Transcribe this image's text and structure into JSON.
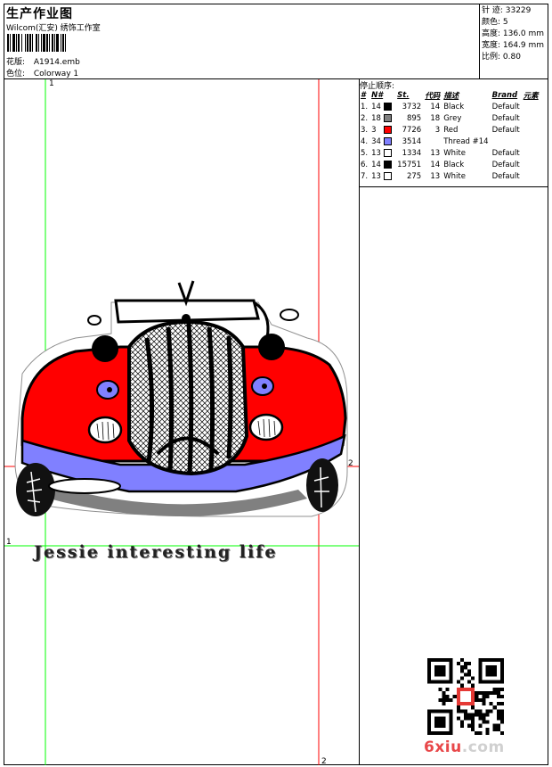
{
  "header": {
    "title": "生产作业图",
    "subtitle": "Wilcom(汇安) 绣饰工作室",
    "design_label": "花版:",
    "design_value": "A1914.emb",
    "colorway_label": "色位:",
    "colorway_value": "Colorway 1"
  },
  "stats": {
    "stitches": "针 迹: 33229",
    "colors": "颜色: 5",
    "height": "高度: 136.0 mm",
    "width": "宽度: 164.9 mm",
    "scale": "比例: 0.80"
  },
  "stop_sequence": {
    "title": "停止顺序:",
    "headers": [
      "#",
      "N#",
      "St.",
      "代码",
      "描述",
      "Brand",
      "元素"
    ],
    "rows": [
      {
        "n": "1.",
        "needle": "14",
        "color": "#000000",
        "st": "3732",
        "code": "14",
        "desc": "Black",
        "brand": "Default"
      },
      {
        "n": "2.",
        "needle": "18",
        "color": "#808080",
        "st": "895",
        "code": "18",
        "desc": "Grey",
        "brand": "Default"
      },
      {
        "n": "3.",
        "needle": "3",
        "color": "#ff0000",
        "st": "7726",
        "code": "3",
        "desc": "Red",
        "brand": "Default"
      },
      {
        "n": "4.",
        "needle": "34",
        "color": "#8080ff",
        "st": "3514",
        "code": "",
        "desc": "Thread #14",
        "brand": ""
      },
      {
        "n": "5.",
        "needle": "13",
        "color": "#ffffff",
        "st": "1334",
        "code": "13",
        "desc": "White",
        "brand": "Default"
      },
      {
        "n": "6.",
        "needle": "14",
        "color": "#000000",
        "st": "15751",
        "code": "14",
        "desc": "Black",
        "brand": "Default"
      },
      {
        "n": "7.",
        "needle": "13",
        "color": "#ffffff",
        "st": "275",
        "code": "13",
        "desc": "White",
        "brand": "Default"
      }
    ]
  },
  "design": {
    "slogan": "Jessie interesting life",
    "guide_marks": [
      "1",
      "2",
      "1",
      "2"
    ],
    "colors": {
      "body": "#ff0000",
      "trim": "#8080ff",
      "outline": "#000000",
      "shadow": "#808080",
      "guide_green": "#00ff00",
      "guide_red": "#ff0000"
    }
  },
  "watermark": {
    "logo_text": "6xiu",
    "logo_suffix": ".com"
  }
}
